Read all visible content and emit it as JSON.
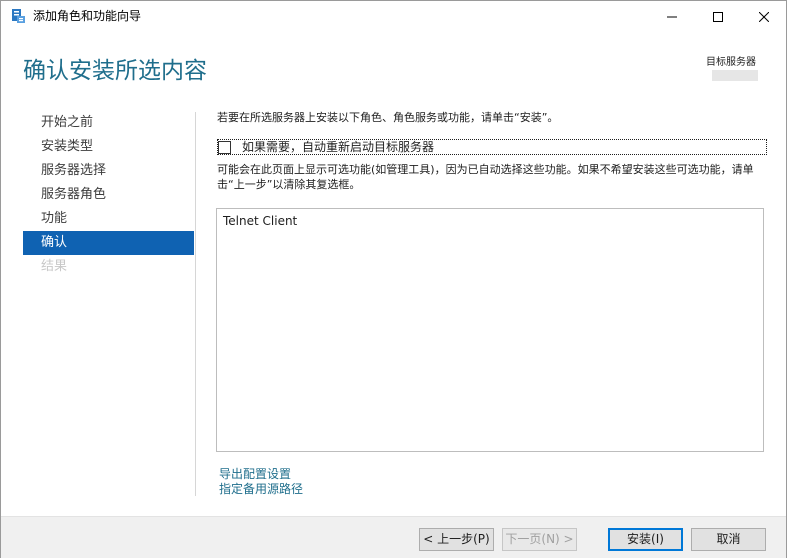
{
  "window": {
    "title": "添加角色和功能向导",
    "icon": "server-manager-icon"
  },
  "header": {
    "page_title": "确认安装所选内容",
    "target_label": "目标服务器"
  },
  "sidebar": {
    "items": [
      {
        "label": "开始之前",
        "state": "normal"
      },
      {
        "label": "安装类型",
        "state": "normal"
      },
      {
        "label": "服务器选择",
        "state": "normal"
      },
      {
        "label": "服务器角色",
        "state": "normal"
      },
      {
        "label": "功能",
        "state": "normal"
      },
      {
        "label": "确认",
        "state": "active"
      },
      {
        "label": "结果",
        "state": "disabled"
      }
    ]
  },
  "main": {
    "intro": "若要在所选服务器上安装以下角色、角色服务或功能，请单击“安装”。",
    "restart_checkbox_label": "如果需要，自动重新启动目标服务器",
    "optional_note": "可能会在此页面上显示可选功能(如管理工具)，因为已自动选择这些功能。如果不希望安装这些可选功能，请单击“上一步”以清除其复选框。",
    "features": [
      "Telnet Client"
    ],
    "links": {
      "export": "导出配置设置",
      "alternate_source": "指定备用源路径"
    }
  },
  "footer": {
    "prev": "< 上一步(P)",
    "next": "下一页(N) >",
    "install": "安装(I)",
    "cancel": "取消"
  },
  "colors": {
    "accent": "#1f6e8c",
    "selected": "#0f62b2"
  }
}
